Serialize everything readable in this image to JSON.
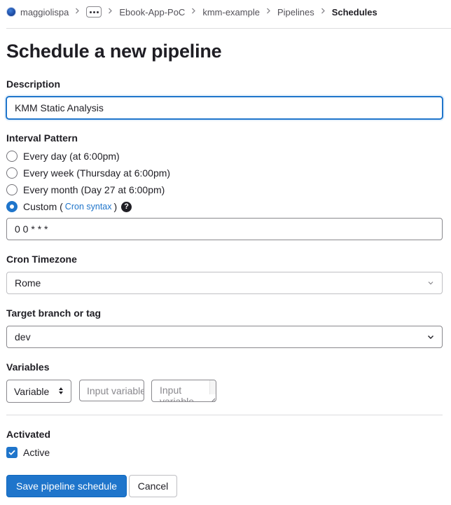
{
  "breadcrumb": {
    "items": [
      "maggiolispa",
      "Ebook-App-PoC",
      "kmm-example",
      "Pipelines",
      "Schedules"
    ],
    "more_icon": "ellipsis-icon",
    "separator_icon": "chevron-right-icon"
  },
  "page": {
    "title": "Schedule a new pipeline"
  },
  "form": {
    "description": {
      "label": "Description",
      "value": "KMM Static Analysis"
    },
    "interval": {
      "label": "Interval Pattern",
      "options": [
        "Every day (at 6:00pm)",
        "Every week (Thursday at 6:00pm)",
        "Every month (Day 27 at 6:00pm)",
        "Custom ("
      ],
      "selected": "Custom",
      "cron_link": "Cron syntax",
      "close_paren": ")",
      "help_icon": "question-circle-icon",
      "cron_value": "0 0 * * *"
    },
    "timezone": {
      "label": "Cron Timezone",
      "value": "Rome"
    },
    "branch": {
      "label": "Target branch or tag",
      "value": "dev"
    },
    "variables": {
      "label": "Variables",
      "type_value": "Variable",
      "key_placeholder": "Input variable key",
      "value_placeholder": "Input variable value"
    },
    "activated": {
      "label": "Activated",
      "checkbox_label": "Active",
      "checked": true
    }
  },
  "actions": {
    "save_label": "Save pipeline schedule",
    "cancel_label": "Cancel"
  },
  "colors": {
    "primary": "#1f75cb",
    "text": "#1f1e24",
    "border": "#89888d"
  }
}
